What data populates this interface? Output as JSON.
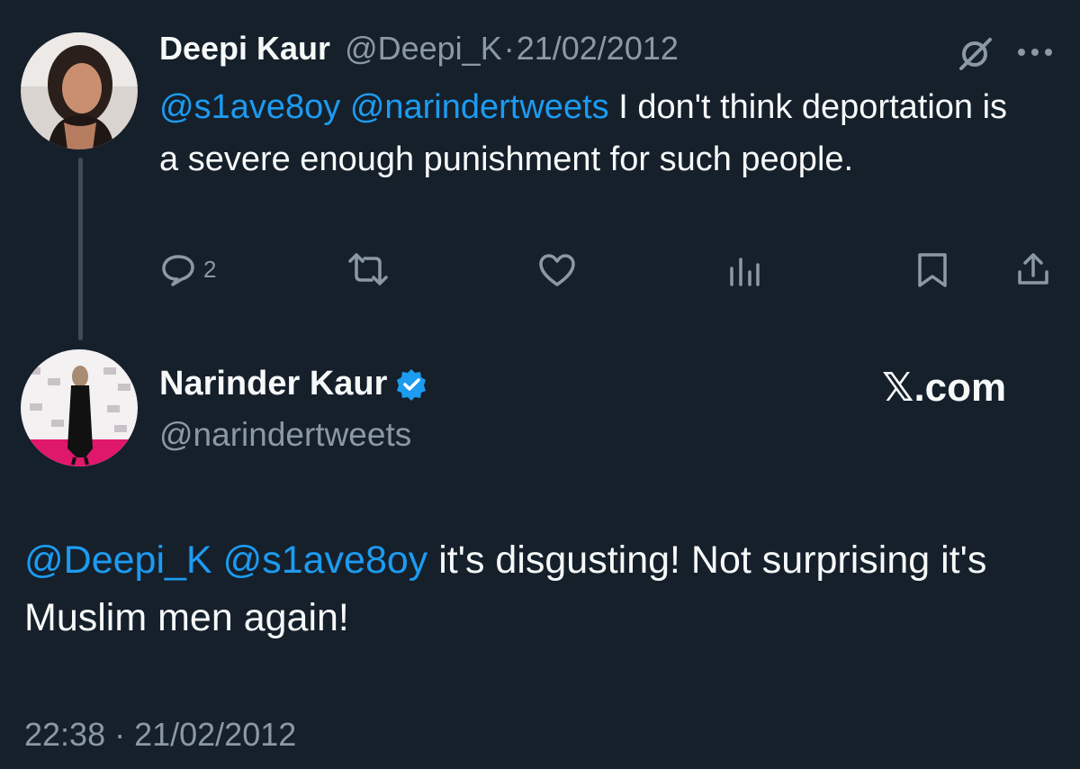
{
  "reply_tweet": {
    "author_name": "Deepi Kaur",
    "author_handle": "@Deepi_K",
    "separator": "·",
    "date": "21/02/2012",
    "mention1": "@s1ave8oy",
    "mention2": "@narindertweets",
    "text": " I don't think deportation is a severe enough punishment for such people.",
    "reply_count": "2",
    "icons": [
      "grok-icon",
      "more-icon",
      "reply-icon",
      "retweet-icon",
      "like-icon",
      "views-icon",
      "bookmark-icon",
      "share-icon"
    ]
  },
  "main_tweet": {
    "author_name": "Narinder Kaur",
    "author_handle": "@narindertweets",
    "badge": "verified-badge-icon",
    "brand": "𝕏.com",
    "mention1": "@Deepi_K",
    "mention2": "@s1ave8oy",
    "text": " it's disgusting! Not surprising it's Muslim men again!",
    "timestamp": "22:38 · 21/02/2012"
  },
  "colors": {
    "background": "#15202b",
    "accent": "#1d9bf0",
    "muted": "#8b98a5",
    "text": "#f7f9f9"
  }
}
